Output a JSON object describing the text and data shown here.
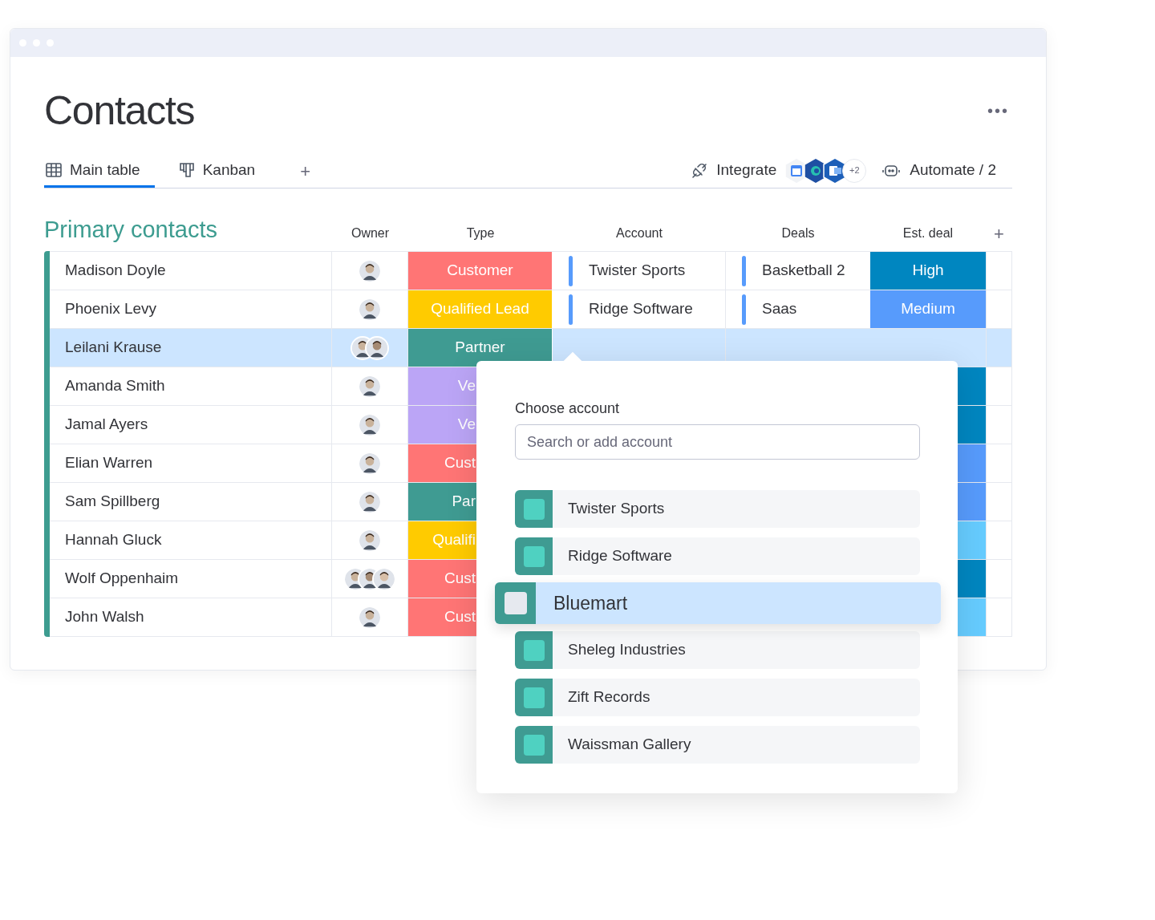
{
  "board": {
    "title": "Contacts",
    "more": "•••"
  },
  "tabs": [
    {
      "label": "Main table",
      "kind": "table",
      "selected": true
    },
    {
      "label": "Kanban",
      "kind": "kanban",
      "selected": false
    }
  ],
  "add_view": "+",
  "toolbar": {
    "integrate": "Integrate",
    "apps_more": "+2",
    "automate": "Automate / 2"
  },
  "group": {
    "title": "Primary contacts",
    "color": "#3d9c90"
  },
  "columns": [
    "Owner",
    "Type",
    "Account",
    "Deals",
    "Est. deal"
  ],
  "add_column": "+",
  "rows": [
    {
      "name": "Madison Doyle",
      "selected": false,
      "type": {
        "label": "Customer",
        "color": "#ff7575"
      },
      "account": "Twister Sports",
      "deal": "Basketball 2",
      "est_deal": {
        "label": "High",
        "color": "#0086c0"
      }
    },
    {
      "name": "Phoenix Levy",
      "selected": false,
      "type": {
        "label": "Qualified Lead",
        "color": "#ffcb00"
      },
      "account": "Ridge Software",
      "deal": "Saas",
      "est_deal": {
        "label": "Medium",
        "color": "#579bfc"
      }
    },
    {
      "name": "Leilani Krause",
      "selected": true,
      "type": {
        "label": "Partner",
        "color": "#3f9b92"
      }
    },
    {
      "name": "Amanda Smith",
      "selected": false,
      "type": {
        "label": "Ve",
        "color": "#bba5f6"
      },
      "est_deal": {
        "color": "#0086c0"
      }
    },
    {
      "name": "Jamal Ayers",
      "selected": false,
      "type": {
        "label": "Ve",
        "color": "#bba5f6"
      },
      "est_deal": {
        "color": "#0086c0"
      }
    },
    {
      "name": "Elian Warren",
      "selected": false,
      "type": {
        "label": "Cust",
        "color": "#ff7575"
      },
      "est_deal": {
        "color": "#579bfc"
      }
    },
    {
      "name": "Sam Spillberg",
      "selected": false,
      "type": {
        "label": "Par",
        "color": "#3f9b92"
      },
      "est_deal": {
        "color": "#579bfc"
      }
    },
    {
      "name": "Hannah Gluck",
      "selected": false,
      "type": {
        "label": "Qualifi",
        "color": "#ffcb00"
      },
      "est_deal": {
        "color": "#66ccff"
      }
    },
    {
      "name": "Wolf Oppenhaim",
      "selected": false,
      "type": {
        "label": "Cust",
        "color": "#ff7575"
      },
      "est_deal": {
        "color": "#0086c0"
      }
    },
    {
      "name": "John Walsh",
      "selected": false,
      "type": {
        "label": "Cust",
        "color": "#ff7575"
      },
      "est_deal": {
        "color": "#66ccff"
      }
    }
  ],
  "popup": {
    "label": "Choose account",
    "placeholder": "Search or add account",
    "options": [
      {
        "name": "Twister Sports",
        "selected": false
      },
      {
        "name": "Ridge Software",
        "selected": false
      },
      {
        "name": "Bluemart",
        "selected": true
      },
      {
        "name": "Sheleg Industries",
        "selected": false
      },
      {
        "name": "Zift Records",
        "selected": false
      },
      {
        "name": "Waissman Gallery",
        "selected": false
      }
    ]
  }
}
